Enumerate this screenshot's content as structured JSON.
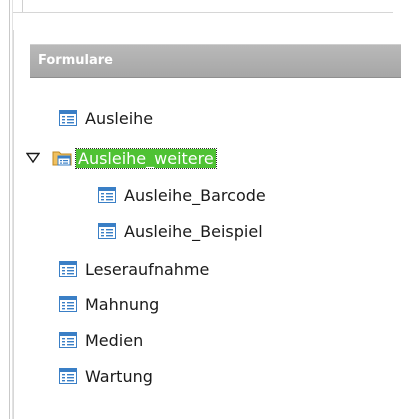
{
  "panel": {
    "title": "Formulare"
  },
  "tree": {
    "items": [
      {
        "label": "Ausleihe",
        "type": "form"
      },
      {
        "label": "Ausleihe_weitere",
        "type": "folder",
        "expanded": true,
        "selected": true
      },
      {
        "label": "Ausleihe_Barcode",
        "type": "form"
      },
      {
        "label": "Ausleihe_Beispiel",
        "type": "form"
      },
      {
        "label": "Leseraufnahme",
        "type": "form"
      },
      {
        "label": "Mahnung",
        "type": "form"
      },
      {
        "label": "Medien",
        "type": "form"
      },
      {
        "label": "Wartung",
        "type": "form"
      }
    ]
  },
  "colors": {
    "header_bg": "#a9a9a9",
    "selection_bg": "#4fc234",
    "icon_blue": "#3a7fc6"
  },
  "icons": {
    "form": "form-document-icon",
    "folder": "folder-icon",
    "expander": "collapse-triangle-icon"
  }
}
